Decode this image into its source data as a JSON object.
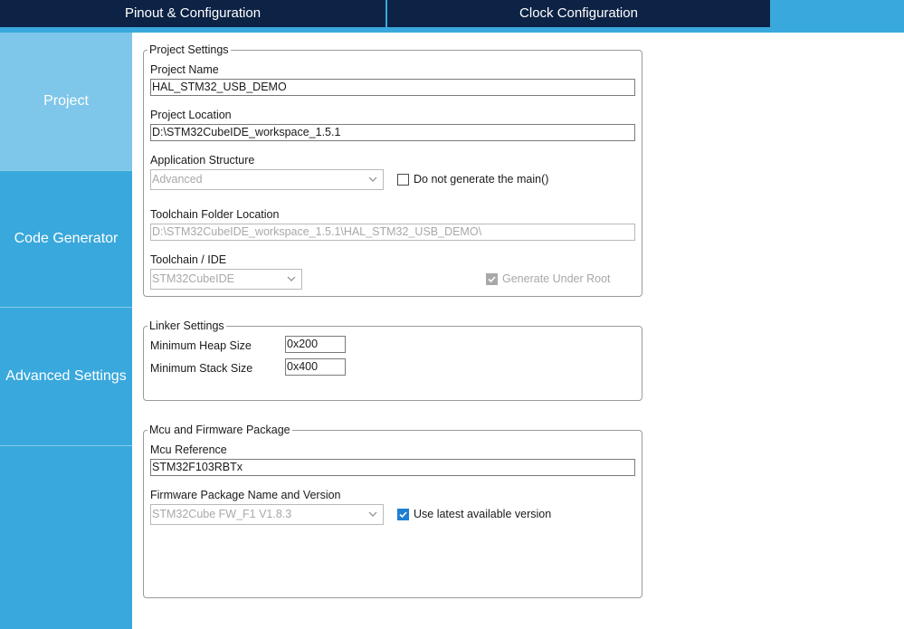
{
  "tabs": {
    "pinout": "Pinout & Configuration",
    "clock": "Clock Configuration"
  },
  "sidebar": {
    "items": [
      {
        "label": "Project",
        "active": true
      },
      {
        "label": "Code Generator",
        "active": false
      },
      {
        "label": "Advanced Settings",
        "active": false
      }
    ]
  },
  "project_settings": {
    "legend": "Project Settings",
    "project_name_label": "Project Name",
    "project_name_value": "HAL_STM32_USB_DEMO",
    "project_location_label": "Project Location",
    "project_location_value": "D:\\STM32CubeIDE_workspace_1.5.1",
    "app_structure_label": "Application Structure",
    "app_structure_value": "Advanced",
    "no_main_label": "Do not generate the main()",
    "no_main_checked": false,
    "toolchain_folder_label": "Toolchain Folder Location",
    "toolchain_folder_value": "D:\\STM32CubeIDE_workspace_1.5.1\\HAL_STM32_USB_DEMO\\",
    "toolchain_ide_label": "Toolchain / IDE",
    "toolchain_ide_value": "STM32CubeIDE",
    "generate_root_label": "Generate Under Root",
    "generate_root_checked": true
  },
  "linker_settings": {
    "legend": "Linker Settings",
    "heap_label": "Minimum Heap Size",
    "heap_value": "0x200",
    "stack_label": "Minimum Stack Size",
    "stack_value": "0x400"
  },
  "mcu_firmware": {
    "legend": "Mcu and Firmware Package",
    "mcu_ref_label": "Mcu Reference",
    "mcu_ref_value": "STM32F103RBTx",
    "fw_label": "Firmware Package Name and Version",
    "fw_value": "STM32Cube FW_F1 V1.8.3",
    "latest_label": "Use latest available version",
    "latest_checked": true
  },
  "colors": {
    "tab_dark": "#0d2345",
    "accent": "#39a8dc",
    "sidebar_active": "#7ec6ea",
    "checkbox_blue": "#1e7fd3"
  }
}
